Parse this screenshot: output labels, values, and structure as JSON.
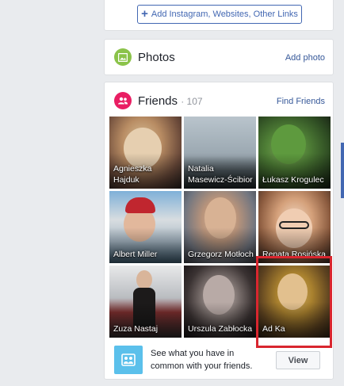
{
  "links_button": {
    "label": "Add Instagram, Websites, Other Links"
  },
  "photos": {
    "title": "Photos",
    "add_link": "Add photo"
  },
  "friends": {
    "title": "Friends",
    "count": "· 107",
    "find_link": "Find Friends",
    "tiles": [
      {
        "name": "Agnieszka Hajduk"
      },
      {
        "name": "Natalia Masewicz-Ścibior"
      },
      {
        "name": "Łukasz Krogulec"
      },
      {
        "name": "Albert Miller"
      },
      {
        "name": "Grzegorz Motłoch"
      },
      {
        "name": "Renata Rosińska"
      },
      {
        "name": "Zuza Nastaj"
      },
      {
        "name": "Urszula Zabłocka"
      },
      {
        "name": "Ad Ka"
      }
    ],
    "suggest_text": "See what you have in common with your friends.",
    "view_label": "View"
  },
  "colors": {
    "accent": "#4267b2",
    "link": "#365899",
    "highlight": "#d9262f"
  }
}
